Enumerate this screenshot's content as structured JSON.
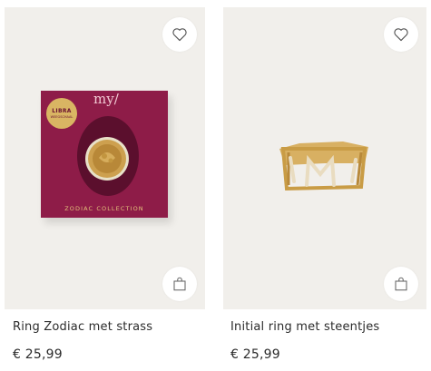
{
  "products": [
    {
      "name": "Ring Zodiac met strass",
      "price": "€ 25,99",
      "packaging": {
        "brand": "my/",
        "sticker_top": "LIBRA",
        "sticker_sub": "WEEGSCHAAL",
        "label": "ZODIAC COLLECTION"
      }
    },
    {
      "name": "Initial ring met steentjes",
      "price": "€ 25,99",
      "ring_letter": "M"
    }
  ],
  "icons": {
    "favorite": "heart-icon",
    "add_to_bag": "shopping-bag-icon"
  },
  "colors": {
    "image_bg": "#f1efeb",
    "box_burgundy": "#8e1c48",
    "gold": "#d9b563"
  }
}
